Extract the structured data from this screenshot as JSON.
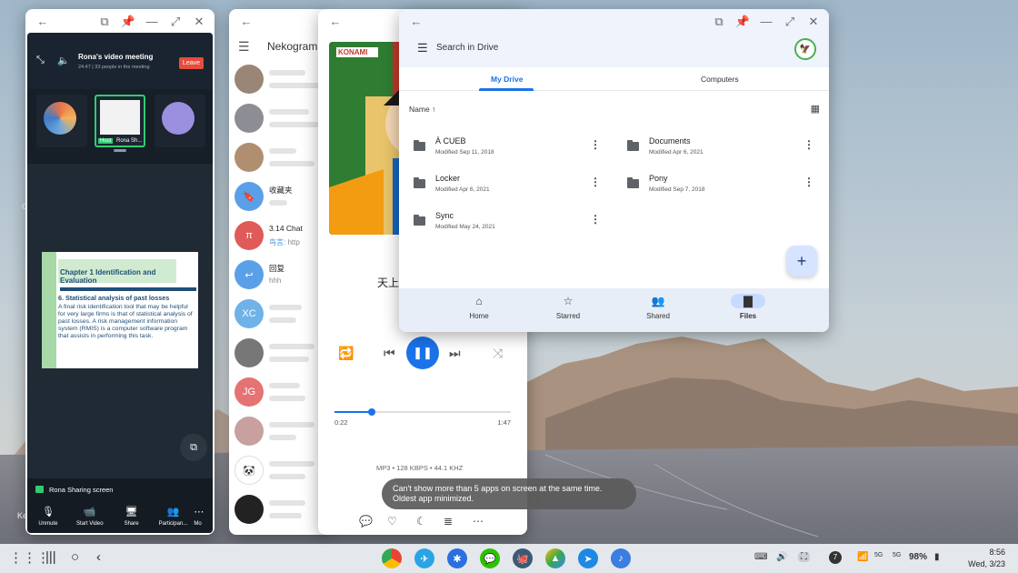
{
  "zoom": {
    "meeting_title": "Rona's video meeting",
    "meeting_time": "24:47",
    "participants_info": "33 people in the meeting",
    "leave_label": "Leave",
    "host_tag": "Host",
    "tile_name": "Rona Sh...",
    "slide_heading": "Chapter 1 Identification and Evaluation",
    "slide_subheading": "6. Statistical analysis of past losses",
    "slide_text": "A final risk identification tool that may be helpful for very large firms is that of statistical analysis of past losses. A risk management information system (RMIS) is a computer software program that assists in performing this task.",
    "sharing_status": "Rona Sharing screen",
    "toolbar": [
      "Unmute",
      "Start Video",
      "Share",
      "Participan...",
      "Mo"
    ]
  },
  "telegram": {
    "title": "Nekogram",
    "chats": [
      {
        "name": "",
        "preview": "",
        "avatar_color": "#9a8676"
      },
      {
        "name": "",
        "preview": "",
        "avatar_color": "#8d8d95"
      },
      {
        "name": "",
        "preview": "",
        "avatar_color": "#b08f70"
      },
      {
        "name": "收藏夹",
        "preview": "",
        "avatar_color": "#5aa0e8",
        "icon": "bookmark"
      },
      {
        "name": "3.14 Chat",
        "preview_prefix": "鸟言:",
        "preview": "http",
        "avatar_color": "#e05a5a",
        "avatar_text": "π"
      },
      {
        "name": "回复",
        "preview": "hhh",
        "avatar_color": "#5aa0e8",
        "icon": "reply"
      },
      {
        "name": "",
        "preview": "",
        "avatar_color": "#6fb2e8",
        "avatar_text": "XC"
      },
      {
        "name": "",
        "preview": "",
        "avatar_color": "#777777"
      },
      {
        "name": "",
        "preview": "",
        "avatar_color": "#e57373",
        "avatar_text": "JG"
      },
      {
        "name": "",
        "preview": "",
        "avatar_color": "#c9a0a0"
      },
      {
        "name": "",
        "preview": "",
        "avatar_color": "#ffffff"
      },
      {
        "name": "",
        "preview": "",
        "avatar_color": "#222222"
      }
    ]
  },
  "music": {
    "album_label": "KONAMI",
    "song_title": "天上",
    "elapsed": "0:22",
    "duration": "1:47",
    "progress": 0.21,
    "audio_info": "MP3 • 128 KBPS • 44.1 KHZ"
  },
  "toast": {
    "line1": "Can't show more than 5 apps on screen at the same time.",
    "line2": "Oldest app minimized."
  },
  "drive": {
    "search_placeholder": "Search in Drive",
    "tabs": [
      "My Drive",
      "Computers"
    ],
    "sort_label": "Name ↑",
    "files": [
      {
        "name": "À CUEB",
        "modified": "Modified Sep 11, 2018"
      },
      {
        "name": "Documents",
        "modified": "Modified Apr 6, 2021"
      },
      {
        "name": "Locker",
        "modified": "Modified Apr 6, 2021"
      },
      {
        "name": "Pony",
        "modified": "Modified Sep 7, 2018"
      },
      {
        "name": "Sync",
        "modified": "Modified May 24, 2021"
      }
    ],
    "nav": [
      "Home",
      "Starred",
      "Shared",
      "Files"
    ],
    "selected_nav": "Files"
  },
  "taskbar": {
    "time": "8:56",
    "date": "Wed, 3/23",
    "battery": "98%",
    "notification_count": "7",
    "signal_1": "5G",
    "signal_2": "5G"
  },
  "edge_text": [
    "Ke",
    "C"
  ]
}
